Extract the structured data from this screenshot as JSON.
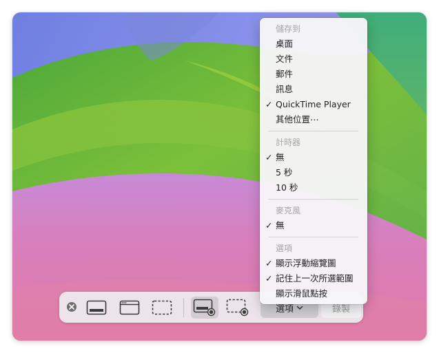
{
  "toolbar": {
    "options_label": "選項",
    "record_label": "錄製",
    "icons": [
      "close-icon",
      "capture-entire-screen-icon",
      "capture-window-icon",
      "capture-selection-icon",
      "record-entire-screen-icon",
      "record-selection-icon"
    ],
    "selected_mode": "record-entire-screen"
  },
  "menu": {
    "save_to_header": "儲存到",
    "desktop": "桌面",
    "documents": "文件",
    "mail": "郵件",
    "messages": "訊息",
    "quicktime": "QuickTime Player",
    "other_location": "其他位置⋯",
    "timer_header": "計時器",
    "timer_none": "無",
    "timer_5s": "5 秒",
    "timer_10s": "10 秒",
    "microphone_header": "麥克風",
    "microphone_none": "無",
    "options_header": "選項",
    "show_floating_thumbnail": "顯示浮動縮覽圖",
    "remember_last_selection": "記住上一次所選範圍",
    "show_mouse_clicks": "顯示滑鼠點按",
    "checkmark": "✓"
  },
  "checked": [
    "quicktime",
    "timer_none",
    "microphone_none",
    "show_floating_thumbnail",
    "remember_last_selection"
  ],
  "colors": {
    "wallpaper_purple": "#7f8be8",
    "wallpaper_green": "#68b838",
    "wallpaper_pink": "#d97bb3",
    "menu_bg": "#f6f5f7",
    "header_gray": "#a6a6a6"
  }
}
